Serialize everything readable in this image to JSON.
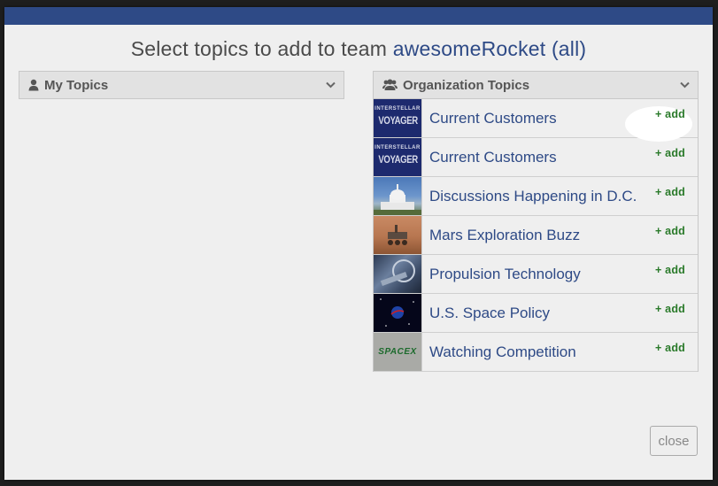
{
  "modal": {
    "title_prefix": "Select topics to add to team",
    "team_name": "awesomeRocket (all)",
    "close_label": "close"
  },
  "my_topics": {
    "label": "My Topics",
    "icon": "user-icon"
  },
  "org_topics": {
    "label": "Organization Topics",
    "icon": "users-icon",
    "items": [
      {
        "name": "Current Customers",
        "thumb": "interstellar-voyager",
        "thumb_line1": "INTERSTELLAR",
        "thumb_line2": "VOYAGER",
        "action": "+ add"
      },
      {
        "name": "Current Customers",
        "thumb": "interstellar-voyager",
        "thumb_line1": "INTERSTELLAR",
        "thumb_line2": "VOYAGER",
        "action": "+ add"
      },
      {
        "name": "Discussions Happening in D.C.",
        "thumb": "capitol-building",
        "action": "+ add"
      },
      {
        "name": "Mars Exploration Buzz",
        "thumb": "mars-rover",
        "action": "+ add"
      },
      {
        "name": "Propulsion Technology",
        "thumb": "spacecraft-engine",
        "action": "+ add"
      },
      {
        "name": "U.S. Space Policy",
        "thumb": "nasa-logo",
        "action": "+ add"
      },
      {
        "name": "Watching Competition",
        "thumb": "spacex-logo",
        "thumb_text": "SPACEX",
        "action": "+ add"
      }
    ]
  },
  "colors": {
    "accent": "#2e4a86",
    "add": "#2a7a2a",
    "header_bar": "#2e4a86"
  }
}
